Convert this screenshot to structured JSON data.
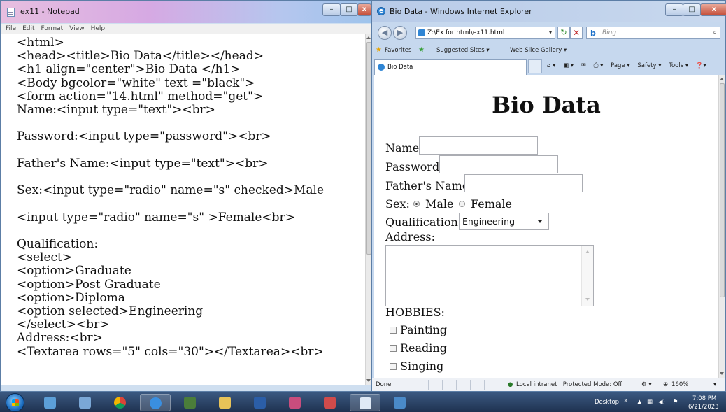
{
  "notepad": {
    "title": "ex11 - Notepad",
    "menu": [
      "File",
      "Edit",
      "Format",
      "View",
      "Help"
    ],
    "code_lines": [
      "<html>",
      "<head><title>Bio Data</title></head>",
      "<h1 align=\"center\">Bio Data </h1>",
      "<Body bgcolor=\"white\" text =\"black\">",
      "<form action=\"14.html\" method=\"get\">",
      "Name:<input type=\"text\"><br>",
      "",
      "Password:<input type=\"password\"><br>",
      "",
      "Father's Name:<input type=\"text\"><br>",
      "",
      "Sex:<input type=\"radio\" name=\"s\" checked>Male",
      "",
      "<input type=\"radio\" name=\"s\" >Female<br>",
      "",
      "Qualification:",
      "<select>",
      "<option>Graduate",
      "<option>Post Graduate",
      "<option>Diploma",
      "<option selected>Engineering",
      "</select><br>",
      "Address:<br>",
      "<Textarea rows=\"5\" cols=\"30\"></Textarea><br>"
    ]
  },
  "ie": {
    "title": "Bio Data - Windows Internet Explorer",
    "address": "Z:\\Ex for html\\ex11.html",
    "search_placeholder": "Bing",
    "favorites": {
      "favorites_label": "Favorites",
      "suggested_sites": "Suggested Sites ▾",
      "web_slice_gallery": "Web Slice Gallery ▾"
    },
    "tab_title": "Bio Data",
    "commands": [
      "Page ▾",
      "Safety ▾",
      "Tools ▾"
    ],
    "page": {
      "heading": "Bio Data",
      "name_label": "Name:",
      "password_label": "Password:",
      "father_label": "Father's Name:",
      "sex_label": "Sex:",
      "male_label": "Male",
      "female_label": "Female",
      "qualification_label": "Qualification:",
      "qualification_selected": "Engineering",
      "address_label": "Address:",
      "hobbies_label": "HOBBIES:",
      "hobbies": [
        "Painting",
        "Reading",
        "Singing"
      ]
    },
    "status": {
      "done": "Done",
      "zone": "Local intranet | Protected Mode: Off",
      "zoom": "160%"
    }
  },
  "taskbar": {
    "desktop_label": "Desktop",
    "time": "7:08 PM",
    "date": "6/21/2023"
  }
}
